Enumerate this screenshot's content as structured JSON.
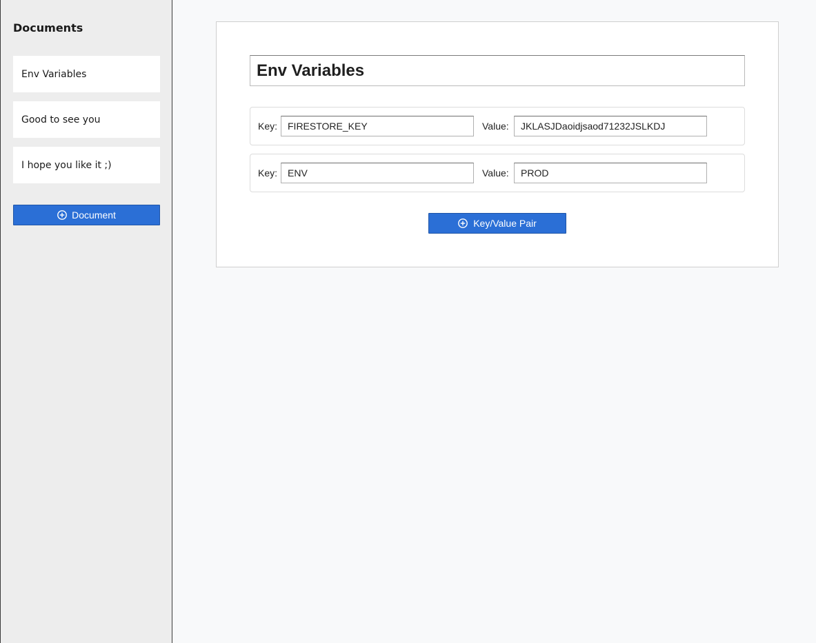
{
  "sidebar": {
    "title": "Documents",
    "documents": [
      {
        "title": "Env Variables"
      },
      {
        "title": "Good to see you"
      },
      {
        "title": "I hope you like it ;)"
      }
    ],
    "add_button_label": "Document"
  },
  "editor": {
    "document_title": "Env Variables",
    "key_label": "Key:",
    "value_label": "Value:",
    "pairs": [
      {
        "key": "FIRESTORE_KEY",
        "value": "JKLASJDaoidjsaod71232JSLKDJ"
      },
      {
        "key": "ENV",
        "value": "PROD"
      }
    ],
    "add_pair_label": "Key/Value Pair"
  },
  "colors": {
    "accent": "#2b6fd6",
    "sidebar_bg": "#ededed",
    "page_bg": "#f8f9fa"
  },
  "icons": {
    "add": "plus-circle-icon"
  }
}
